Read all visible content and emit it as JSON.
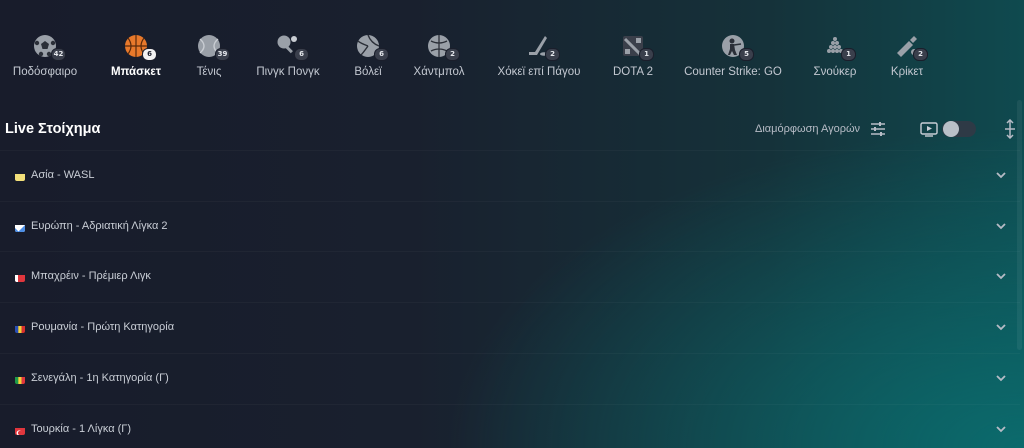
{
  "sports": [
    {
      "label": "Ποδόσφαιρο",
      "count": "42",
      "icon": "soccer-ball-icon",
      "active": false
    },
    {
      "label": "Μπάσκετ",
      "count": "6",
      "icon": "basketball-icon",
      "active": true
    },
    {
      "label": "Τένις",
      "count": "39",
      "icon": "tennis-ball-icon",
      "active": false
    },
    {
      "label": "Πινγκ Πονγκ",
      "count": "6",
      "icon": "ping-pong-icon",
      "active": false
    },
    {
      "label": "Βόλεϊ",
      "count": "6",
      "icon": "volleyball-icon",
      "active": false
    },
    {
      "label": "Χάντμπολ",
      "count": "2",
      "icon": "handball-icon",
      "active": false
    },
    {
      "label": "Χόκεϊ επί Πάγου",
      "count": "2",
      "icon": "ice-hockey-icon",
      "active": false
    },
    {
      "label": "DOTA 2",
      "count": "1",
      "icon": "dota-icon",
      "active": false
    },
    {
      "label": "Counter Strike: GO",
      "count": "5",
      "icon": "counter-strike-icon",
      "active": false
    },
    {
      "label": "Σνούκερ",
      "count": "1",
      "icon": "snooker-icon",
      "active": false
    },
    {
      "label": "Κρίκετ",
      "count": "2",
      "icon": "cricket-icon",
      "active": false
    }
  ],
  "header": {
    "title": "Live Στοίχημα",
    "market_config": "Διαμόρφωση Αγορών"
  },
  "leagues": [
    {
      "name": "Ασία - WASL",
      "flag": "asia-flag",
      "colors": [
        "#f3e07a",
        "#f3e07a"
      ]
    },
    {
      "name": "Ευρώπη - Αδριατική Λίγκα 2",
      "flag": "europe-flag",
      "colors": [
        "#4c8ee6",
        "#ffffff"
      ]
    },
    {
      "name": "Μπαχρέιν - Πρέμιερ Λιγκ",
      "flag": "bahrain-flag",
      "colors": [
        "#ffffff",
        "#e0363d"
      ]
    },
    {
      "name": "Ρουμανία - Πρώτη Κατηγορία",
      "flag": "romania-flag",
      "colors": [
        "#2a4fb5",
        "#f4d13a",
        "#d62f2f"
      ]
    },
    {
      "name": "Σενεγάλη - 1η Κατηγορία (Γ)",
      "flag": "senegal-flag",
      "colors": [
        "#1f9b4a",
        "#f4d13a",
        "#e0363d"
      ]
    },
    {
      "name": "Τουρκία - 1 Λίγκα (Γ)",
      "flag": "turkey-flag",
      "colors": [
        "#e0363d",
        "#e0363d"
      ]
    }
  ]
}
